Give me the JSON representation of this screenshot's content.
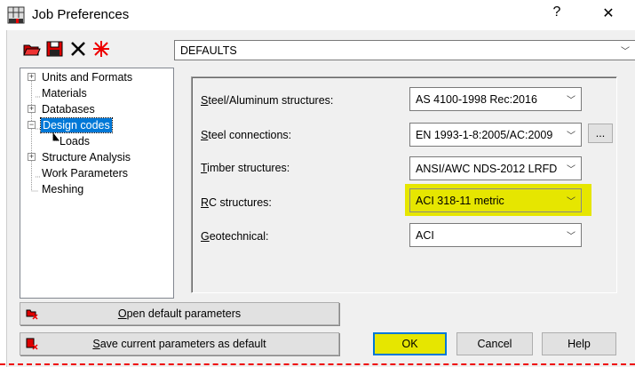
{
  "window": {
    "title": "Job Preferences",
    "help": "?",
    "close": "✕"
  },
  "profile": {
    "value": "DEFAULTS"
  },
  "toolbar": [
    "open-icon",
    "save-icon",
    "delete-icon",
    "reset-icon"
  ],
  "tree": [
    {
      "label": "Units and Formats",
      "expander": "+"
    },
    {
      "label": "Materials"
    },
    {
      "label": "Databases",
      "expander": "+"
    },
    {
      "label": "Design codes",
      "expander": "−",
      "selected": true
    },
    {
      "label": "Loads"
    },
    {
      "label": "Structure Analysis",
      "expander": "+"
    },
    {
      "label": "Work Parameters"
    },
    {
      "label": "Meshing"
    }
  ],
  "codes": [
    {
      "ul": "S",
      "rest": "teel/Aluminum structures:",
      "value": "AS 4100-1998 Rec:2016"
    },
    {
      "ul": "S",
      "rest": "teel connections:",
      "value": "EN 1993-1-8:2005/AC:2009",
      "extra": "..."
    },
    {
      "ul": "T",
      "rest": "imber structures:",
      "value": "ANSI/AWC NDS-2012 LRFD"
    },
    {
      "ul": "R",
      "rest": "C structures:",
      "value": "ACI 318-11 metric",
      "highlight": "#e6e600"
    },
    {
      "ul": "G",
      "rest": "eotechnical:",
      "value": "ACI"
    }
  ],
  "buttons": {
    "open_ul": "O",
    "open_rest": "pen default parameters",
    "save_ul": "S",
    "save_rest": "ave current parameters as default",
    "ok": "OK",
    "cancel": "Cancel",
    "help": "Help"
  }
}
